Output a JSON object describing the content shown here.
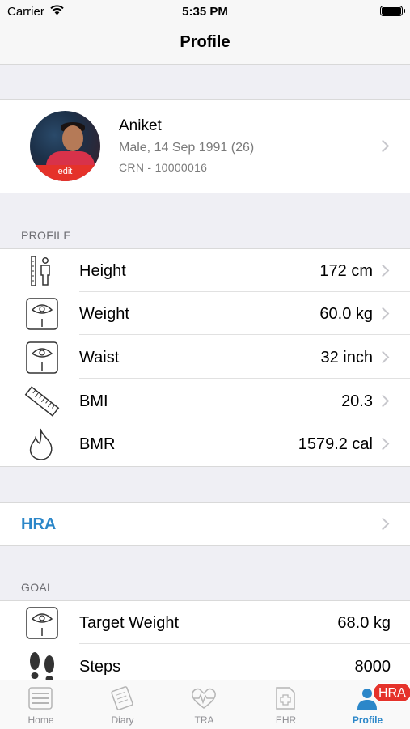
{
  "status": {
    "carrier": "Carrier",
    "time": "5:35 PM"
  },
  "nav": {
    "title": "Profile"
  },
  "profile_card": {
    "avatar_edit": "edit",
    "name": "Aniket",
    "details": "Male, 14 Sep 1991 (26)",
    "crn": "CRN - 10000016"
  },
  "profile_section": {
    "header": "PROFILE",
    "rows": [
      {
        "label": "Height",
        "value": "172 cm",
        "icon": "height-icon"
      },
      {
        "label": "Weight",
        "value": "60.0 kg",
        "icon": "scale-icon"
      },
      {
        "label": "Waist",
        "value": "32 inch",
        "icon": "scale-icon"
      },
      {
        "label": "BMI",
        "value": "20.3",
        "icon": "ruler-icon"
      },
      {
        "label": "BMR",
        "value": "1579.2 cal",
        "icon": "flame-icon"
      }
    ]
  },
  "hra": {
    "label": "HRA"
  },
  "goal_section": {
    "header": "GOAL",
    "rows": [
      {
        "label": "Target Weight",
        "value": "68.0 kg",
        "icon": "scale-icon"
      },
      {
        "label": "Steps",
        "value": "8000",
        "icon": "footsteps-icon"
      }
    ]
  },
  "tabs": [
    {
      "label": "Home",
      "icon": "home-icon"
    },
    {
      "label": "Diary",
      "icon": "diary-icon"
    },
    {
      "label": "TRA",
      "icon": "heart-pulse-icon"
    },
    {
      "label": "EHR",
      "icon": "medical-record-icon"
    },
    {
      "label": "Profile",
      "icon": "person-icon",
      "active": true
    }
  ],
  "badge": {
    "label": "HRA"
  },
  "colors": {
    "accent": "#2c87c9",
    "badge": "#e5322a",
    "background": "#efeff4"
  }
}
